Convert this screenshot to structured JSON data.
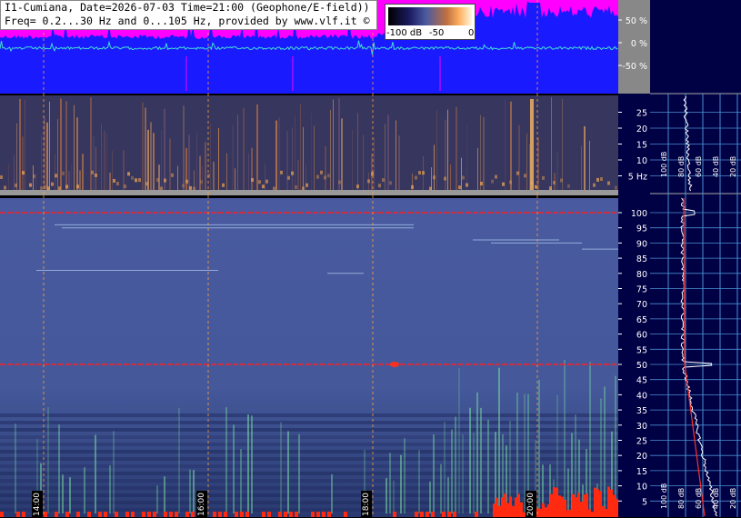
{
  "header": {
    "line1": "I1-Cumiana, Date=2026-07-03 Time=21:00 (Geophone/E-field))",
    "line2": "Freq= 0.2...30 Hz and 0...105 Hz, provided by www.vlf.it ©"
  },
  "colorbar": {
    "ticks": [
      "-100 dB",
      "-50",
      "0"
    ]
  },
  "colors": {
    "waveform_bg": "#1a1aff",
    "amplitude_fill": "#ff00ff",
    "panel_bg": "#000044",
    "grid_line": "#4a8fd0",
    "marker_red": "#ff2020"
  },
  "chart_data": [
    {
      "type": "line",
      "name": "waveform",
      "yaxis_ticks": [
        "50 %",
        "0 %",
        "-50 %"
      ],
      "ylim": [
        -100,
        100
      ]
    },
    {
      "type": "heatmap",
      "name": "low-frequency spectrogram",
      "ytick_values": [
        5,
        10,
        15,
        20,
        25
      ],
      "ytick_labels": [
        "5 Hz",
        "10",
        "15",
        "20",
        "25"
      ],
      "ylim": [
        0,
        30
      ]
    },
    {
      "type": "heatmap",
      "name": "high-frequency spectrogram",
      "ytick_values": [
        5,
        10,
        15,
        20,
        25,
        30,
        35,
        40,
        45,
        50,
        55,
        60,
        65,
        70,
        75,
        80,
        85,
        90,
        95,
        100
      ],
      "ylim": [
        0,
        105
      ],
      "x_time_labels": [
        "14:00",
        "16:00",
        "18:00",
        "20:00"
      ],
      "spectral_lines_hz": [
        50,
        100
      ]
    },
    {
      "type": "line",
      "name": "spectrum profile",
      "xtick_labels": [
        "100 dB",
        "80 dB",
        "60 dB",
        "40 dB",
        "20 dB"
      ]
    }
  ]
}
